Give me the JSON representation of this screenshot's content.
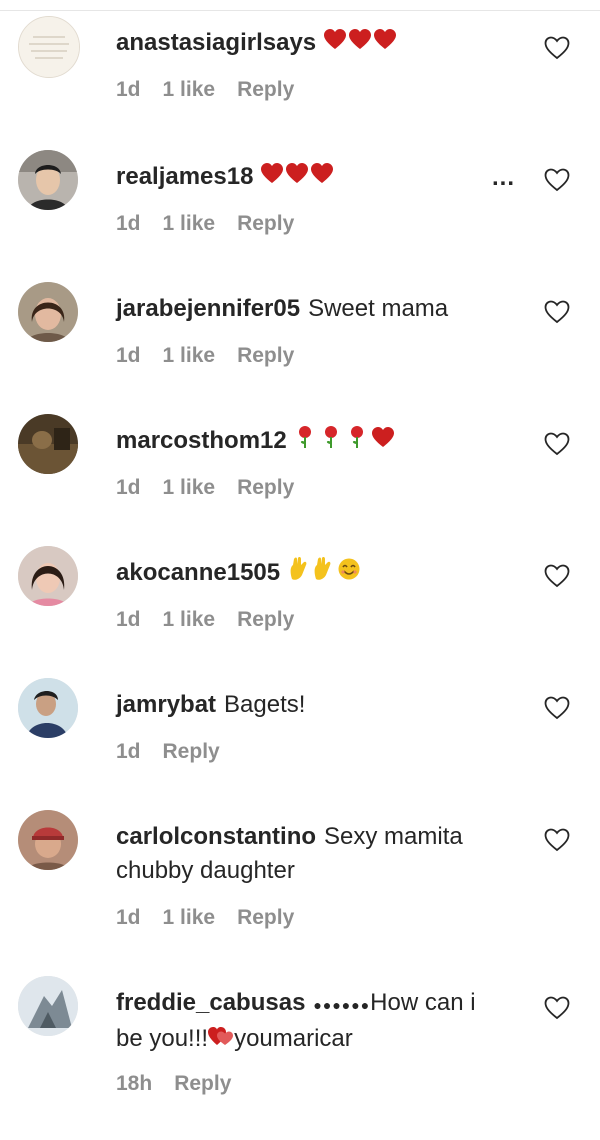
{
  "comments": [
    {
      "username": "anastasiagirlsays",
      "text": "",
      "emoji": [
        "heart",
        "heart",
        "heart"
      ],
      "time": "1d",
      "likes": "1 like",
      "reply": "Reply"
    },
    {
      "username": "realjames18",
      "text": "",
      "emoji": [
        "heart",
        "heart",
        "heart"
      ],
      "time": "1d",
      "likes": "1 like",
      "reply": "Reply",
      "more": "..."
    },
    {
      "username": "jarabejennifer05",
      "text": "Sweet mama",
      "emoji": [],
      "time": "1d",
      "likes": "1 like",
      "reply": "Reply"
    },
    {
      "username": "marcosthom12",
      "text": "",
      "emoji": [
        "rose",
        "rose",
        "rose",
        "heart"
      ],
      "time": "1d",
      "likes": "1 like",
      "reply": "Reply"
    },
    {
      "username": "akocanne1505",
      "text": "",
      "emoji": [
        "raised-hand",
        "raised-hand",
        "smiling-face"
      ],
      "time": "1d",
      "likes": "1 like",
      "reply": "Reply"
    },
    {
      "username": "jamrybat",
      "text": "Bagets!",
      "emoji": [],
      "time": "1d",
      "likes": "",
      "reply": "Reply"
    },
    {
      "username": "carlolconstantino",
      "text_line1": "Sexy mamita",
      "text_line2": "chubby daughter",
      "time": "1d",
      "likes": "1 like",
      "reply": "Reply"
    },
    {
      "username": "freddie_cabusas",
      "text_prefix": "●●●●●●",
      "text_line1_rest": "How can i",
      "text_line2a": "be you!!!",
      "text_line2b": "youmaricar",
      "time": "18h",
      "likes": "",
      "reply": "Reply"
    }
  ],
  "colors": {
    "heart": "#cc1f1f",
    "meta": "#8e8e8e",
    "text": "#262626"
  },
  "icons": {
    "like": "heart-outline-icon",
    "more": "more-options-icon"
  }
}
